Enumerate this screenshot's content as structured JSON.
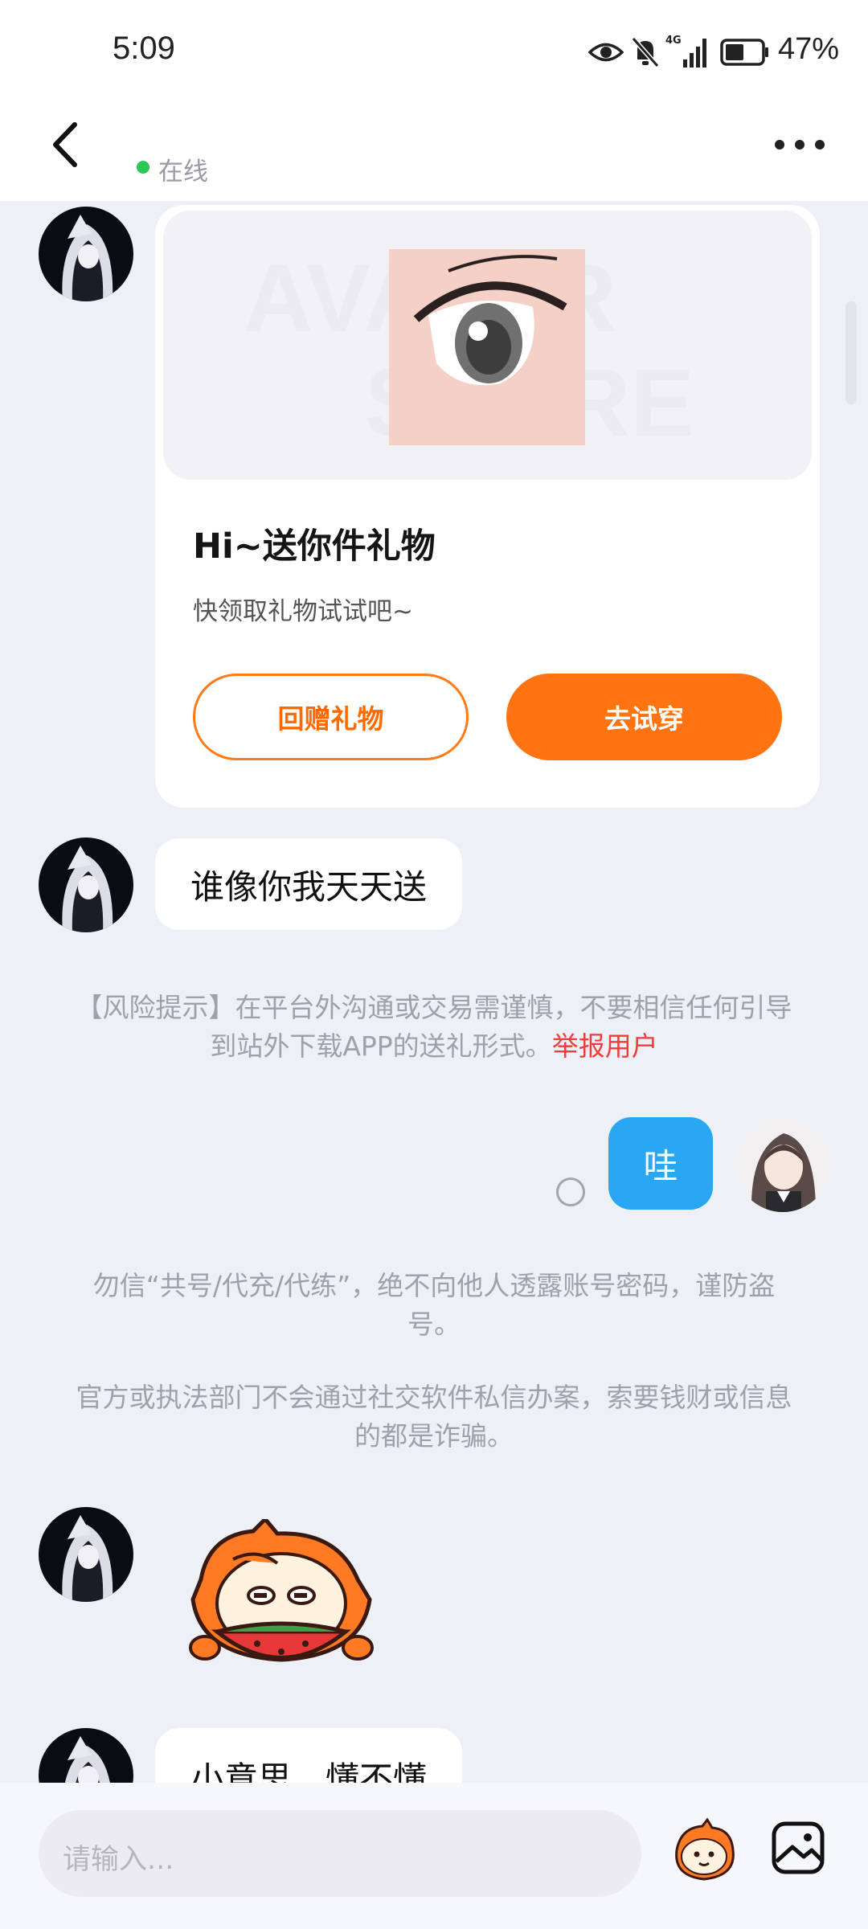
{
  "status_bar": {
    "time": "5:09",
    "network": "4G",
    "battery_pct": "47%"
  },
  "header": {
    "status": "在线"
  },
  "gift_card": {
    "title": "Hi~送你件礼物",
    "subtitle": "快领取礼物试试吧~",
    "return_label": "回赠礼物",
    "try_label": "去试穿",
    "watermark": "AVATAR STORE"
  },
  "messages": {
    "incoming_1": "谁像你我天天送",
    "outgoing_1": "哇",
    "incoming_2": "小意思，懂不懂"
  },
  "notices": {
    "risk_prefix": "【风险提示】在平台外沟通或交易需谨慎，不要相信任何引导到站外下载APP的送礼形式。",
    "report_link": "举报用户",
    "account_warning": "勿信“共号/代充/代练”，绝不向他人透露账号密码，谨防盗号。",
    "official_warning": "官方或执法部门不会通过社交软件私信办案，索要钱财或信息的都是诈骗。"
  },
  "composer": {
    "placeholder": "请输入..."
  },
  "colors": {
    "accent_orange": "#ff7311",
    "bubble_blue": "#29a7f2",
    "online_green": "#2bc653",
    "report_red": "#f23c3c"
  },
  "icons": {
    "back": "chevron-left-icon",
    "more": "more-horizontal-icon",
    "emoji": "mascot-emoji-icon",
    "image": "image-icon"
  }
}
